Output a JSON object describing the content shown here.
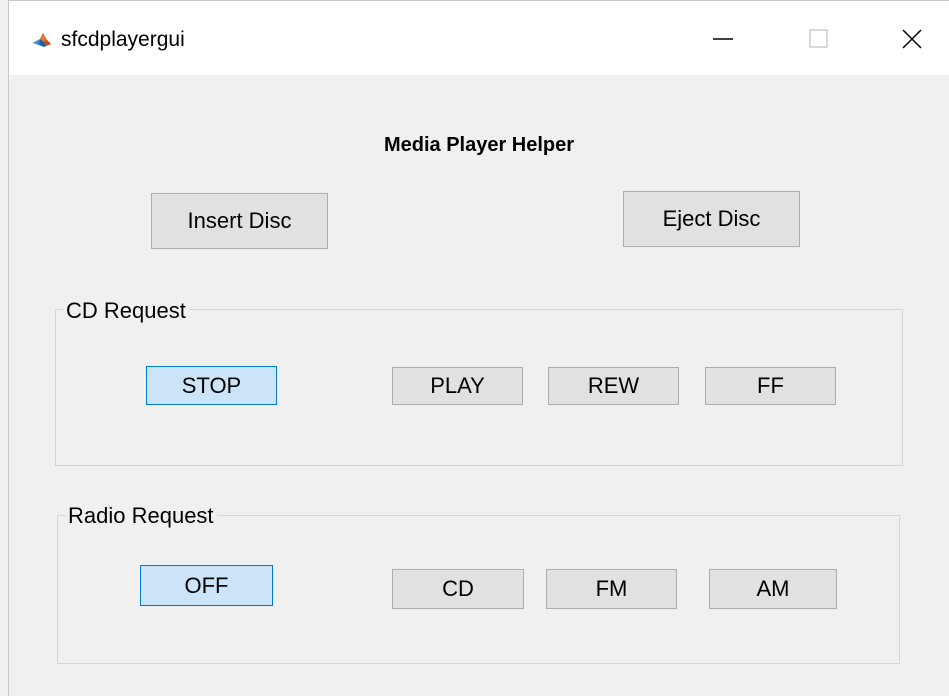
{
  "window": {
    "title": "sfcdplayergui"
  },
  "heading": "Media Player Helper",
  "disc_buttons": {
    "insert": "Insert Disc",
    "eject": "Eject Disc"
  },
  "cd_request": {
    "label": "CD Request",
    "buttons": [
      "STOP",
      "PLAY",
      "REW",
      "FF"
    ],
    "selected": "STOP"
  },
  "radio_request": {
    "label": "Radio Request",
    "buttons": [
      "OFF",
      "CD",
      "FM",
      "AM"
    ],
    "selected": "OFF"
  },
  "colors": {
    "selected_fill": "#cce4f7",
    "selected_border": "#0078d7",
    "button_fill": "#e1e1e1"
  },
  "icons": {
    "app": "matlab-logo-icon",
    "minimize": "minimize-icon",
    "maximize": "maximize-icon",
    "close": "close-icon"
  }
}
